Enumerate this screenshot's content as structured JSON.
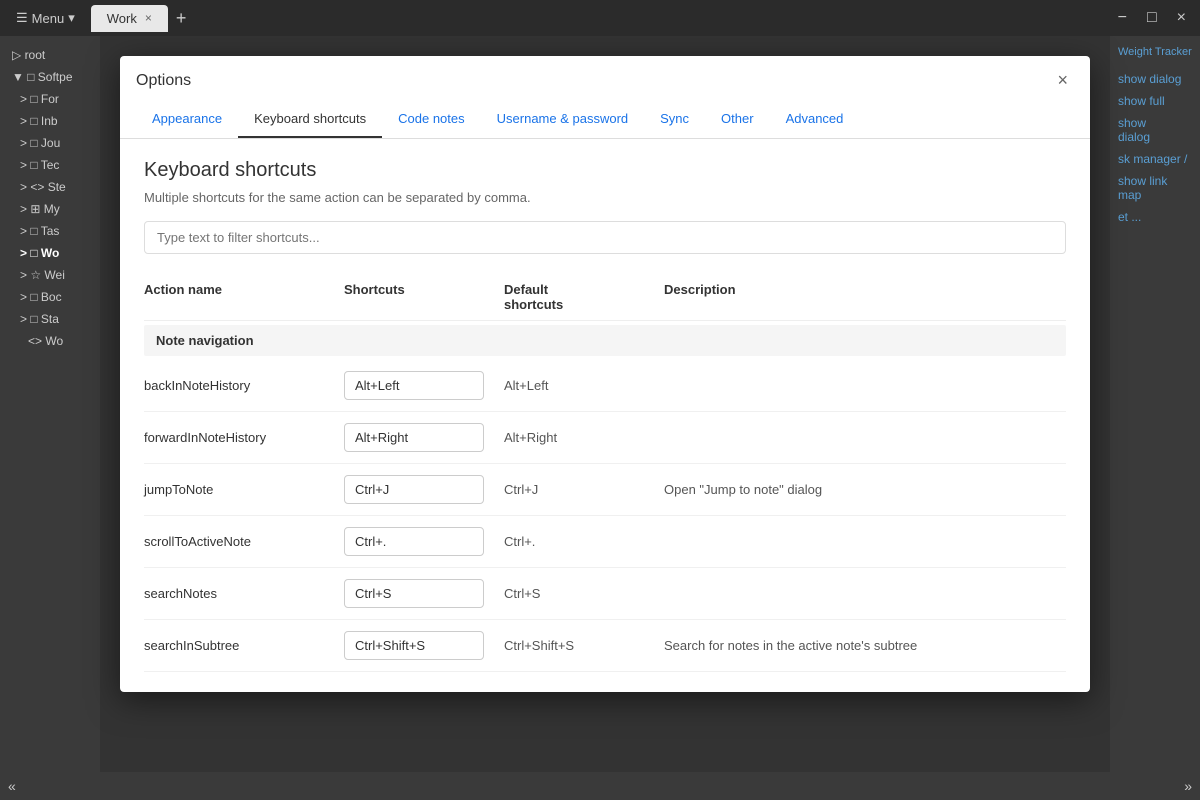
{
  "titlebar": {
    "menu_label": "Menu",
    "tab_label": "Work",
    "tab_close": "×",
    "tab_add": "+",
    "win_min": "−",
    "win_max": "□",
    "win_close": "×"
  },
  "sidebar": {
    "items": [
      {
        "label": "root",
        "level": 0,
        "bold": false
      },
      {
        "label": "▼ □ Softpe",
        "level": 0,
        "bold": false
      },
      {
        "label": "> □ For",
        "level": 1,
        "bold": false
      },
      {
        "label": "> □ Inb",
        "level": 1,
        "bold": false
      },
      {
        "label": "> □ Jou",
        "level": 1,
        "bold": false
      },
      {
        "label": "> □ Tec",
        "level": 1,
        "bold": false
      },
      {
        "label": "> <> Ste",
        "level": 1,
        "bold": false
      },
      {
        "label": "> ⊞ My",
        "level": 1,
        "bold": false
      },
      {
        "label": "> □ Tas",
        "level": 1,
        "bold": false
      },
      {
        "label": "> □ Wo",
        "level": 1,
        "bold": true
      },
      {
        "label": "> ☆ Wei",
        "level": 1,
        "bold": false
      },
      {
        "label": "> □ Boc",
        "level": 1,
        "bold": false
      },
      {
        "label": "> □ Sta",
        "level": 1,
        "bold": false
      },
      {
        "label": "  <> Wo",
        "level": 2,
        "bold": false
      }
    ]
  },
  "right_panel": {
    "links": [
      "show dialog",
      "show full",
      "show\ndialog",
      "sk manager /",
      "show link\nmap",
      "et ...",
      "Weight Tracker"
    ]
  },
  "dialog": {
    "title": "Options",
    "close_btn": "×",
    "tabs": [
      {
        "label": "Appearance",
        "active": false
      },
      {
        "label": "Keyboard shortcuts",
        "active": true
      },
      {
        "label": "Code notes",
        "active": false
      },
      {
        "label": "Username & password",
        "active": false
      },
      {
        "label": "Sync",
        "active": false
      },
      {
        "label": "Other",
        "active": false
      },
      {
        "label": "Advanced",
        "active": false
      }
    ],
    "section_title": "Keyboard shortcuts",
    "section_desc": "Multiple shortcuts for the same action can be separated by comma.",
    "filter_placeholder": "Type text to filter shortcuts...",
    "table_headers": [
      "Action name",
      "Shortcuts",
      "Default shortcuts",
      "Description"
    ],
    "group_note_navigation": "Note navigation",
    "shortcuts": [
      {
        "action": "backInNoteHistory",
        "shortcut": "Alt+Left",
        "default": "Alt+Left",
        "description": ""
      },
      {
        "action": "forwardInNoteHistory",
        "shortcut": "Alt+Right",
        "default": "Alt+Right",
        "description": ""
      },
      {
        "action": "jumpToNote",
        "shortcut": "Ctrl+J",
        "default": "Ctrl+J",
        "description": "Open \"Jump to note\" dialog"
      },
      {
        "action": "scrollToActiveNote",
        "shortcut": "Ctrl+.",
        "default": "Ctrl+.",
        "description": ""
      },
      {
        "action": "searchNotes",
        "shortcut": "Ctrl+S",
        "default": "Ctrl+S",
        "description": ""
      },
      {
        "action": "searchInSubtree",
        "shortcut": "Ctrl+Shift+S",
        "default": "Ctrl+Shift+S",
        "description": "Search for notes in the active note's subtree"
      }
    ]
  },
  "bottom_bar": {
    "left_arrow": "«",
    "right_arrow": "»"
  }
}
